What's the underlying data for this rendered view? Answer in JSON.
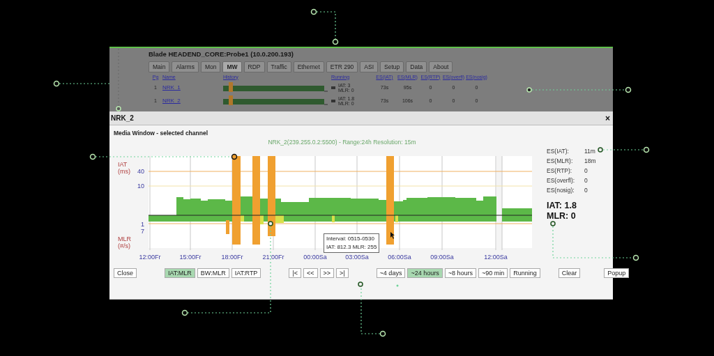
{
  "background_window": {
    "title": "Blade HEADEND_CORE:Probe1 (10.0.200.193)",
    "tabs": [
      {
        "label": "Main",
        "selected": false
      },
      {
        "label": "Alarms",
        "selected": false
      },
      {
        "label": "Mon",
        "selected": false
      },
      {
        "label": "MW",
        "selected": true
      },
      {
        "label": "RDP",
        "selected": false
      },
      {
        "label": "Traffic",
        "selected": false
      },
      {
        "label": "Ethernet",
        "selected": false
      },
      {
        "label": "ETR 290",
        "selected": false
      },
      {
        "label": "ASI",
        "selected": false
      },
      {
        "label": "Setup",
        "selected": false
      },
      {
        "label": "Data",
        "selected": false
      },
      {
        "label": "About",
        "selected": false
      }
    ],
    "columns": [
      "Pg",
      "Name",
      "History",
      "Running",
      "ES(IAT)",
      "ES(MLR)",
      "ES(RTP)",
      "ES(overfl)",
      "ES(nosig)"
    ],
    "rows": [
      {
        "pg": "1",
        "name": "NRK_1",
        "running": [
          "IAT: 3",
          "MLR: 0"
        ],
        "values": [
          "73s",
          "95s",
          "0",
          "0",
          "0"
        ]
      },
      {
        "pg": "1",
        "name": "NRK_2",
        "running": [
          "IAT: 1.8",
          "MLR: 0"
        ],
        "values": [
          "73s",
          "106s",
          "0",
          "0",
          "0"
        ]
      }
    ]
  },
  "dialog": {
    "title": "NRK_2",
    "close": "×",
    "heading": "Media Window - selected channel",
    "chart": {
      "title": "NRK_2(239.255.0.2:5500) - Range:24h Resolution: 15m",
      "iat_label": [
        "IAT",
        "(ms)"
      ],
      "mlr_label": [
        "MLR",
        "(#/s)"
      ],
      "y_ticks": [
        "40",
        "10",
        "1",
        "7"
      ],
      "x_ticks": [
        "12:00Fr",
        "15:00Fr",
        "18:00Fr",
        "21:00Fr",
        "00:00Sa",
        "03:00Sa",
        "06:00Sa",
        "09:00Sa",
        "12:00Sa"
      ],
      "tooltip": [
        "Interval: 0515-0530",
        "IAT: 812.3  MLR: 255"
      ]
    },
    "stats": [
      {
        "label": "ES(IAT):",
        "value": "11m"
      },
      {
        "label": "ES(MLR):",
        "value": "18m"
      },
      {
        "label": "ES(RTP):",
        "value": "0"
      },
      {
        "label": "ES(overfl):",
        "value": "0"
      },
      {
        "label": "ES(nosig):",
        "value": "0"
      }
    ],
    "summary": [
      "IAT: 1.8",
      "MLR: 0"
    ],
    "button_groups": [
      [
        {
          "label": "Close",
          "selected": false
        }
      ],
      [
        {
          "label": "IAT:MLR",
          "selected": true
        },
        {
          "label": "BW:MLR",
          "selected": false
        },
        {
          "label": "IAT:RTP",
          "selected": false
        }
      ],
      [
        {
          "label": "|<",
          "selected": false
        },
        {
          "label": "<<",
          "selected": false
        },
        {
          "label": ">>",
          "selected": false
        },
        {
          "label": ">|",
          "selected": false
        }
      ],
      [
        {
          "label": "~4 days",
          "selected": false
        },
        {
          "label": "~24 hours",
          "selected": true
        },
        {
          "label": "~8 hours",
          "selected": false
        },
        {
          "label": "~90 min",
          "selected": false
        },
        {
          "label": "Running",
          "selected": false
        }
      ],
      [
        {
          "label": "Clear",
          "selected": false
        }
      ],
      [
        {
          "label": "Popup",
          "selected": false
        }
      ]
    ]
  }
}
